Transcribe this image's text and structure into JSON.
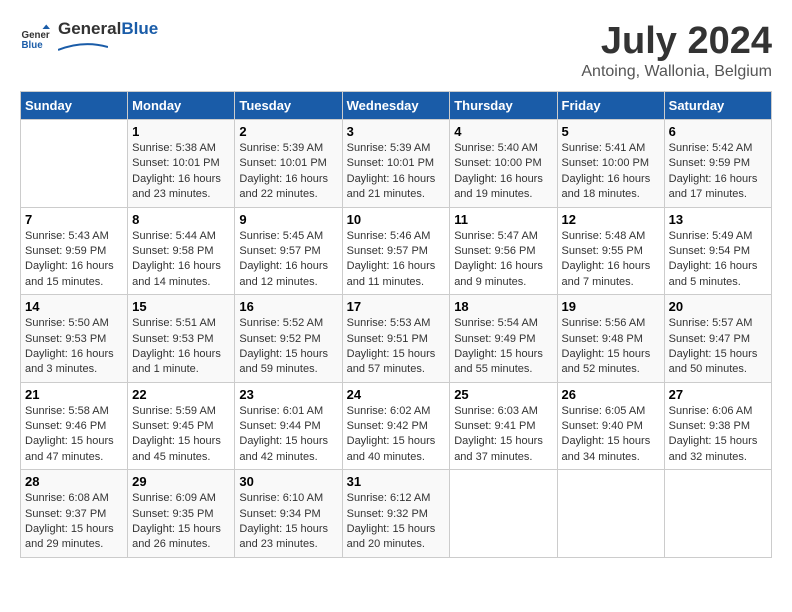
{
  "header": {
    "logo_text_general": "General",
    "logo_text_blue": "Blue",
    "month_year": "July 2024",
    "location": "Antoing, Wallonia, Belgium"
  },
  "columns": [
    "Sunday",
    "Monday",
    "Tuesday",
    "Wednesday",
    "Thursday",
    "Friday",
    "Saturday"
  ],
  "weeks": [
    [
      {
        "day": "",
        "info": ""
      },
      {
        "day": "1",
        "info": "Sunrise: 5:38 AM\nSunset: 10:01 PM\nDaylight: 16 hours\nand 23 minutes."
      },
      {
        "day": "2",
        "info": "Sunrise: 5:39 AM\nSunset: 10:01 PM\nDaylight: 16 hours\nand 22 minutes."
      },
      {
        "day": "3",
        "info": "Sunrise: 5:39 AM\nSunset: 10:01 PM\nDaylight: 16 hours\nand 21 minutes."
      },
      {
        "day": "4",
        "info": "Sunrise: 5:40 AM\nSunset: 10:00 PM\nDaylight: 16 hours\nand 19 minutes."
      },
      {
        "day": "5",
        "info": "Sunrise: 5:41 AM\nSunset: 10:00 PM\nDaylight: 16 hours\nand 18 minutes."
      },
      {
        "day": "6",
        "info": "Sunrise: 5:42 AM\nSunset: 9:59 PM\nDaylight: 16 hours\nand 17 minutes."
      }
    ],
    [
      {
        "day": "7",
        "info": "Sunrise: 5:43 AM\nSunset: 9:59 PM\nDaylight: 16 hours\nand 15 minutes."
      },
      {
        "day": "8",
        "info": "Sunrise: 5:44 AM\nSunset: 9:58 PM\nDaylight: 16 hours\nand 14 minutes."
      },
      {
        "day": "9",
        "info": "Sunrise: 5:45 AM\nSunset: 9:57 PM\nDaylight: 16 hours\nand 12 minutes."
      },
      {
        "day": "10",
        "info": "Sunrise: 5:46 AM\nSunset: 9:57 PM\nDaylight: 16 hours\nand 11 minutes."
      },
      {
        "day": "11",
        "info": "Sunrise: 5:47 AM\nSunset: 9:56 PM\nDaylight: 16 hours\nand 9 minutes."
      },
      {
        "day": "12",
        "info": "Sunrise: 5:48 AM\nSunset: 9:55 PM\nDaylight: 16 hours\nand 7 minutes."
      },
      {
        "day": "13",
        "info": "Sunrise: 5:49 AM\nSunset: 9:54 PM\nDaylight: 16 hours\nand 5 minutes."
      }
    ],
    [
      {
        "day": "14",
        "info": "Sunrise: 5:50 AM\nSunset: 9:53 PM\nDaylight: 16 hours\nand 3 minutes."
      },
      {
        "day": "15",
        "info": "Sunrise: 5:51 AM\nSunset: 9:53 PM\nDaylight: 16 hours\nand 1 minute."
      },
      {
        "day": "16",
        "info": "Sunrise: 5:52 AM\nSunset: 9:52 PM\nDaylight: 15 hours\nand 59 minutes."
      },
      {
        "day": "17",
        "info": "Sunrise: 5:53 AM\nSunset: 9:51 PM\nDaylight: 15 hours\nand 57 minutes."
      },
      {
        "day": "18",
        "info": "Sunrise: 5:54 AM\nSunset: 9:49 PM\nDaylight: 15 hours\nand 55 minutes."
      },
      {
        "day": "19",
        "info": "Sunrise: 5:56 AM\nSunset: 9:48 PM\nDaylight: 15 hours\nand 52 minutes."
      },
      {
        "day": "20",
        "info": "Sunrise: 5:57 AM\nSunset: 9:47 PM\nDaylight: 15 hours\nand 50 minutes."
      }
    ],
    [
      {
        "day": "21",
        "info": "Sunrise: 5:58 AM\nSunset: 9:46 PM\nDaylight: 15 hours\nand 47 minutes."
      },
      {
        "day": "22",
        "info": "Sunrise: 5:59 AM\nSunset: 9:45 PM\nDaylight: 15 hours\nand 45 minutes."
      },
      {
        "day": "23",
        "info": "Sunrise: 6:01 AM\nSunset: 9:44 PM\nDaylight: 15 hours\nand 42 minutes."
      },
      {
        "day": "24",
        "info": "Sunrise: 6:02 AM\nSunset: 9:42 PM\nDaylight: 15 hours\nand 40 minutes."
      },
      {
        "day": "25",
        "info": "Sunrise: 6:03 AM\nSunset: 9:41 PM\nDaylight: 15 hours\nand 37 minutes."
      },
      {
        "day": "26",
        "info": "Sunrise: 6:05 AM\nSunset: 9:40 PM\nDaylight: 15 hours\nand 34 minutes."
      },
      {
        "day": "27",
        "info": "Sunrise: 6:06 AM\nSunset: 9:38 PM\nDaylight: 15 hours\nand 32 minutes."
      }
    ],
    [
      {
        "day": "28",
        "info": "Sunrise: 6:08 AM\nSunset: 9:37 PM\nDaylight: 15 hours\nand 29 minutes."
      },
      {
        "day": "29",
        "info": "Sunrise: 6:09 AM\nSunset: 9:35 PM\nDaylight: 15 hours\nand 26 minutes."
      },
      {
        "day": "30",
        "info": "Sunrise: 6:10 AM\nSunset: 9:34 PM\nDaylight: 15 hours\nand 23 minutes."
      },
      {
        "day": "31",
        "info": "Sunrise: 6:12 AM\nSunset: 9:32 PM\nDaylight: 15 hours\nand 20 minutes."
      },
      {
        "day": "",
        "info": ""
      },
      {
        "day": "",
        "info": ""
      },
      {
        "day": "",
        "info": ""
      }
    ]
  ]
}
